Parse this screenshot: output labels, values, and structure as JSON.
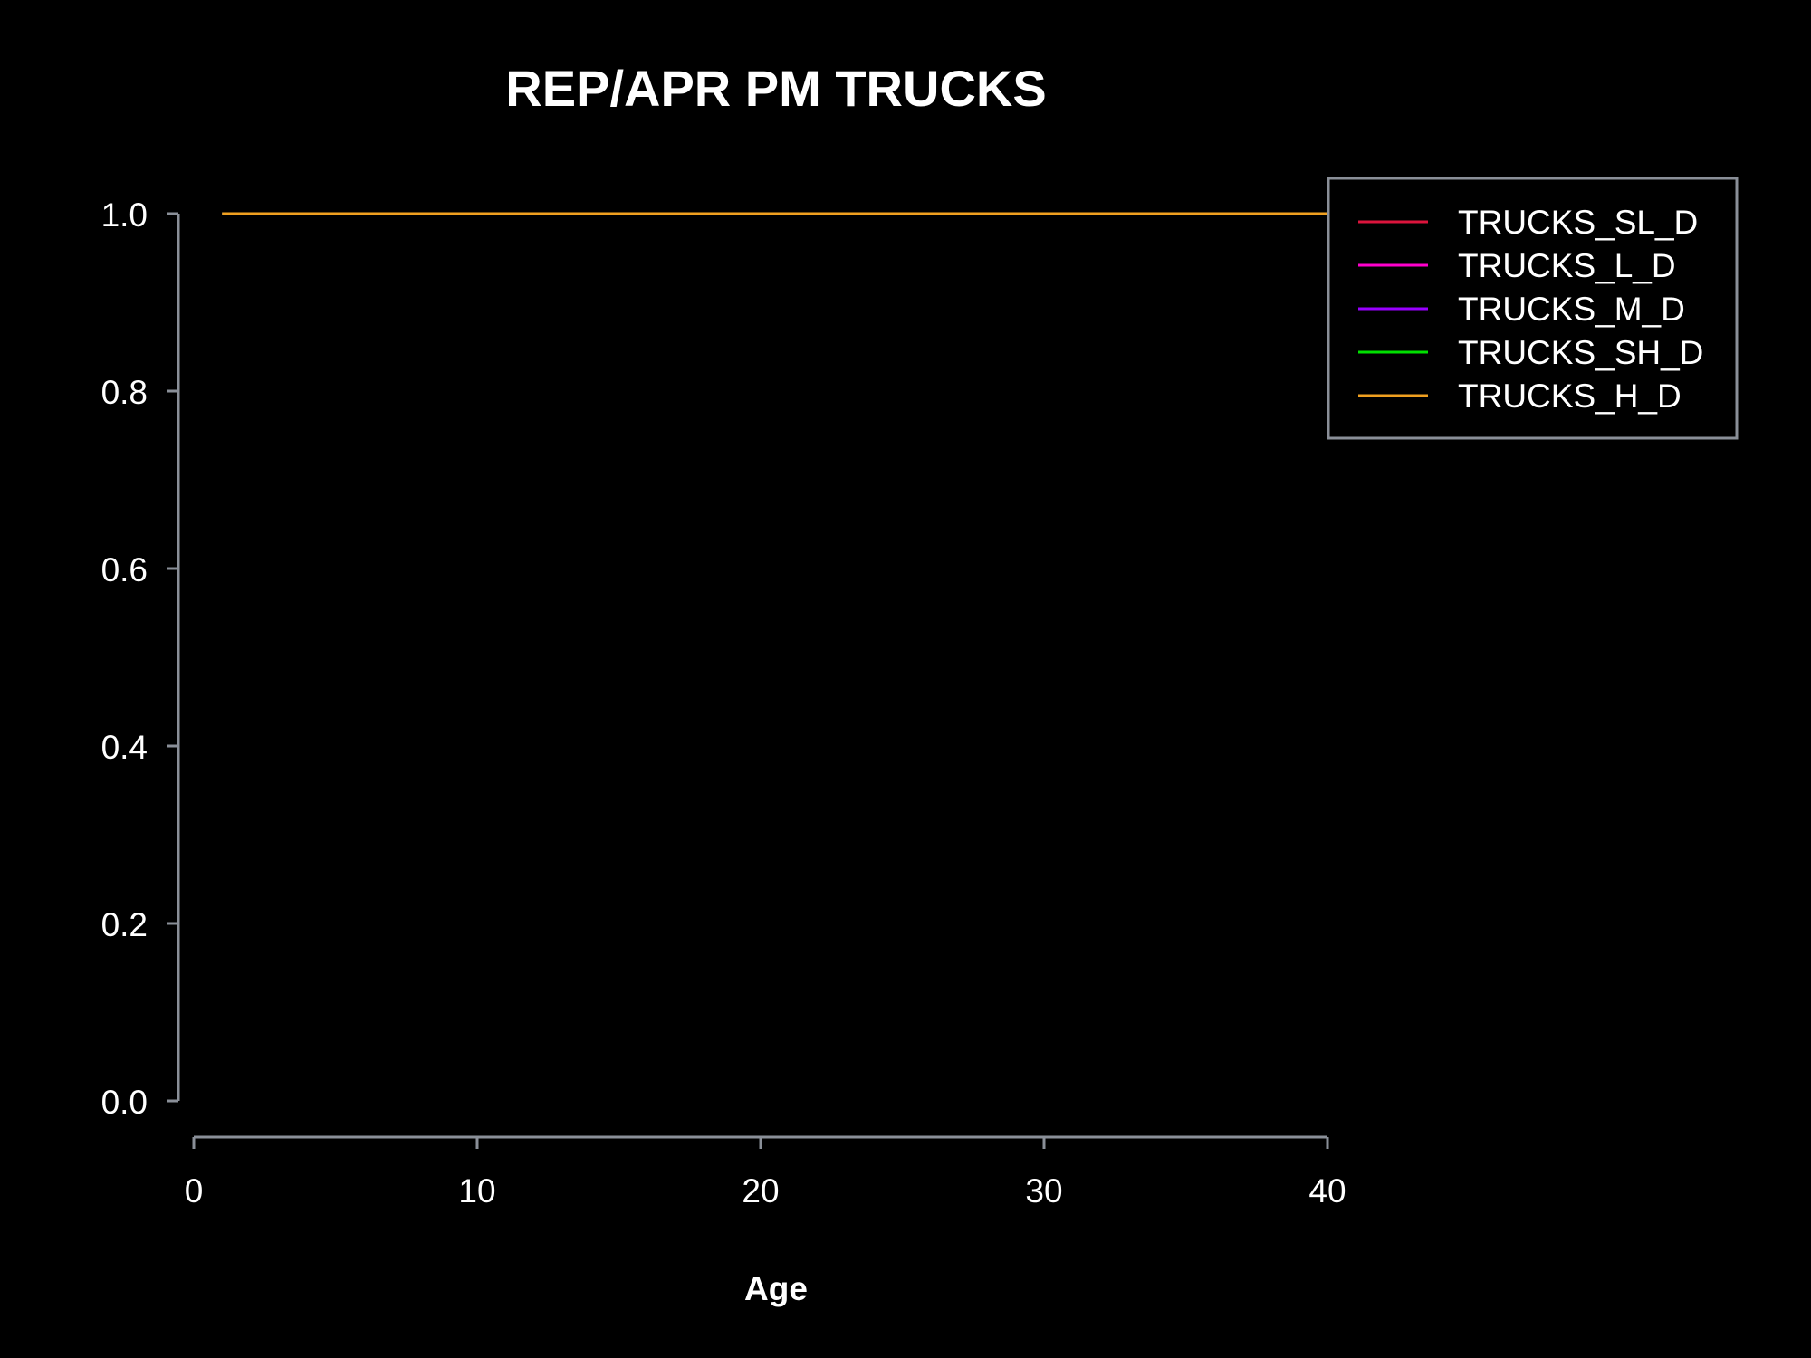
{
  "chart_data": {
    "type": "line",
    "title": "REP/APR PM TRUCKS",
    "xlabel": "Age",
    "ylabel": "",
    "xlim": [
      0,
      40
    ],
    "ylim": [
      0,
      1
    ],
    "x_ticks": [
      "0",
      "10",
      "20",
      "30",
      "40"
    ],
    "y_ticks": [
      "0.0",
      "0.2",
      "0.4",
      "0.6",
      "0.8",
      "1.0"
    ],
    "grid": false,
    "legend_position": "top-right",
    "x": [
      1,
      40
    ],
    "series": [
      {
        "name": "TRUCKS_SL_D",
        "color": "#dc143c",
        "values": [
          1.0,
          1.0
        ]
      },
      {
        "name": "TRUCKS_L_D",
        "color": "#ff00cc",
        "values": [
          1.0,
          1.0
        ]
      },
      {
        "name": "TRUCKS_M_D",
        "color": "#9900ff",
        "values": [
          1.0,
          1.0
        ]
      },
      {
        "name": "TRUCKS_SH_D",
        "color": "#00e000",
        "values": [
          1.0,
          1.0
        ]
      },
      {
        "name": "TRUCKS_H_D",
        "color": "#f0a020",
        "values": [
          1.0,
          1.0
        ]
      }
    ],
    "colors": {
      "background": "#000000",
      "axis": "#8a8f98",
      "text": "#ffffff"
    }
  }
}
